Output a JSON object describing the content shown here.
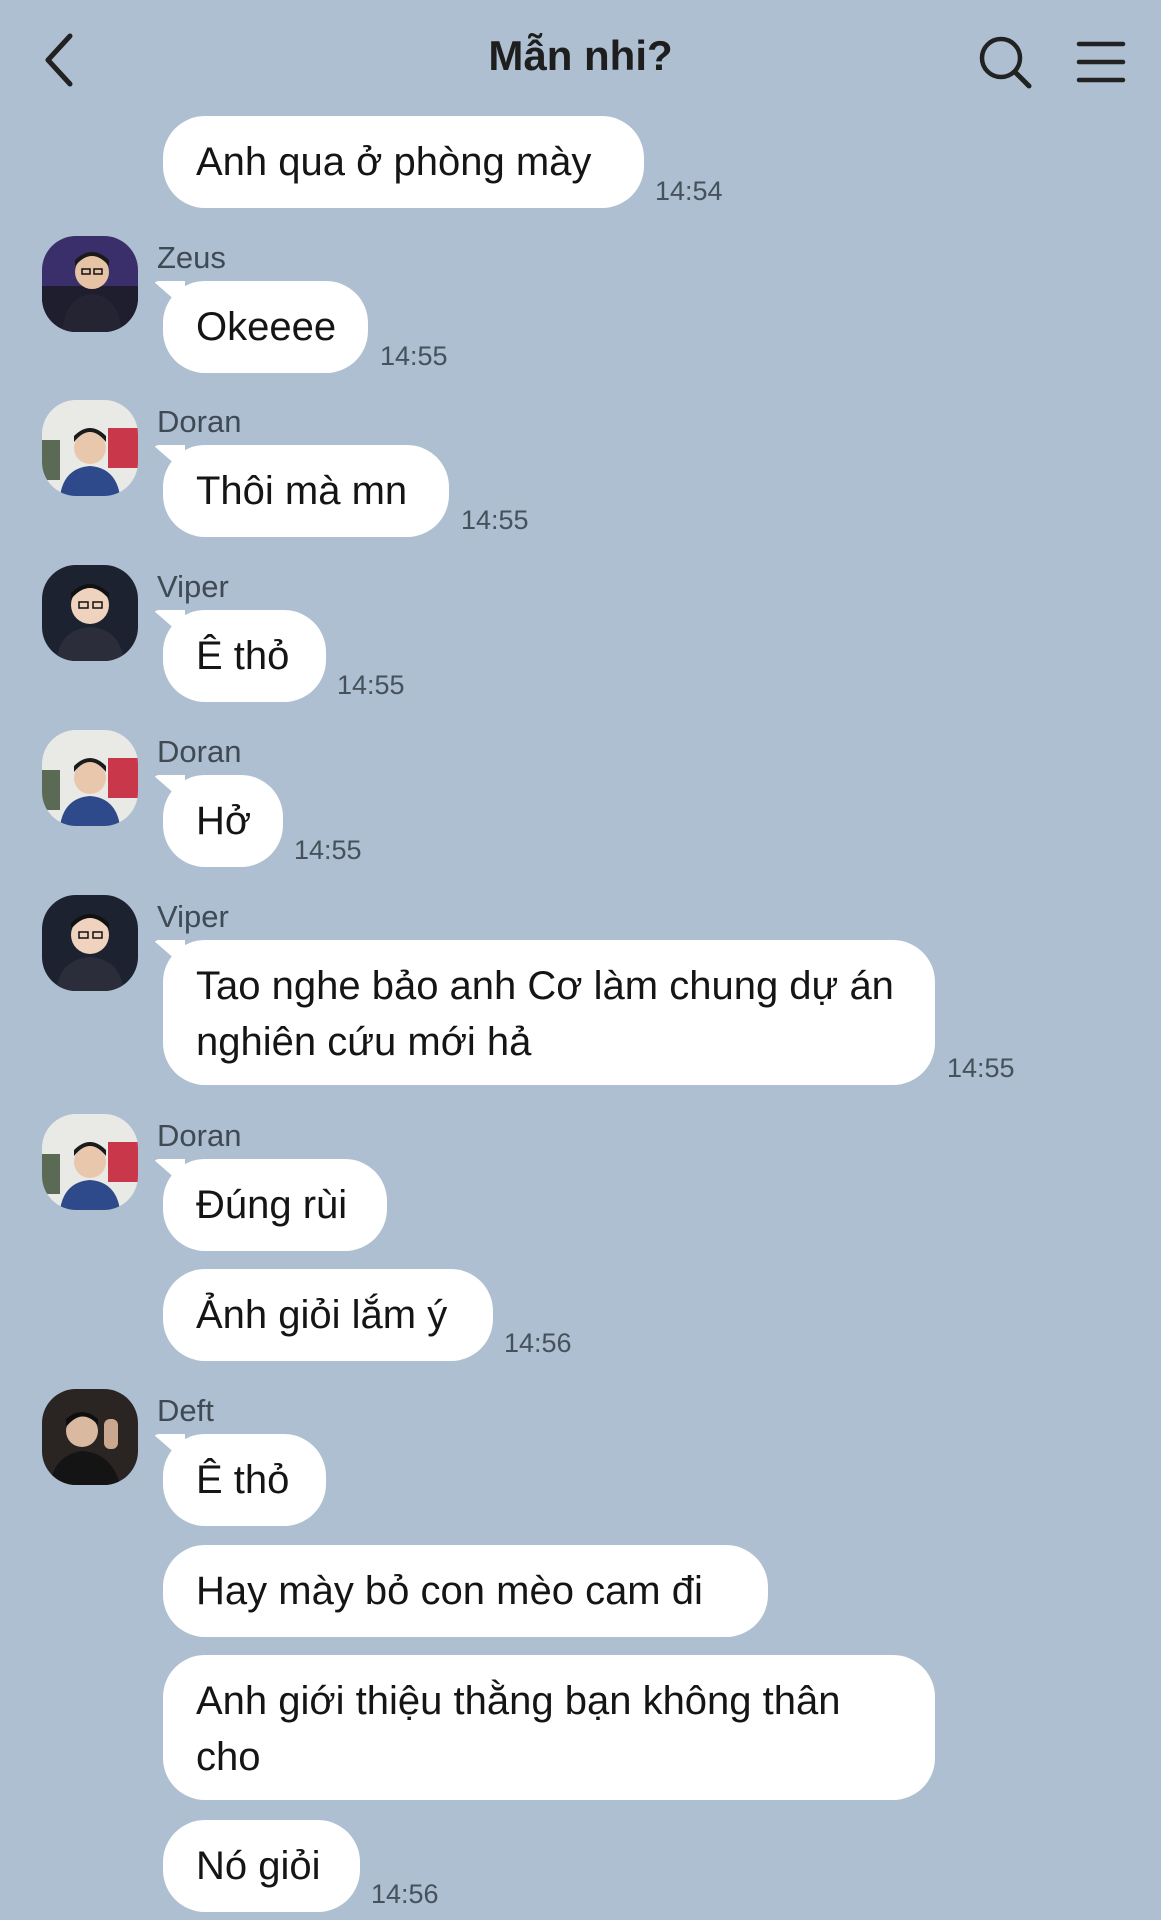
{
  "header": {
    "title": "Mẫn nhi?",
    "back_icon": "chevron-left-icon",
    "search_icon": "search-icon",
    "menu_icon": "hamburger-menu-icon"
  },
  "messages": [
    {
      "sender": "",
      "text": "Anh qua ở phòng mày",
      "time": "14:54"
    },
    {
      "sender": "Zeus",
      "text": "Okeeee",
      "time": "14:55"
    },
    {
      "sender": "Doran",
      "text": "Thôi mà mn",
      "time": "14:55"
    },
    {
      "sender": "Viper",
      "text": "Ê thỏ",
      "time": "14:55"
    },
    {
      "sender": "Doran",
      "text": "Hở",
      "time": "14:55"
    },
    {
      "sender": "Viper",
      "text": "Tao nghe bảo anh Cơ làm chung dự án nghiên cứu mới hả",
      "time": "14:55"
    },
    {
      "sender": "Doran",
      "text": "Đúng rùi",
      "time": ""
    },
    {
      "sender": "",
      "text": "Ảnh giỏi lắm ý",
      "time": "14:56"
    },
    {
      "sender": "Deft",
      "text": "Ê thỏ",
      "time": ""
    },
    {
      "sender": "",
      "text": "Hay mày bỏ con mèo cam đi",
      "time": ""
    },
    {
      "sender": "",
      "text": "Anh giới thiệu thằng bạn không thân cho",
      "time": ""
    },
    {
      "sender": "",
      "text": "Nó giỏi",
      "time": "14:56"
    }
  ]
}
